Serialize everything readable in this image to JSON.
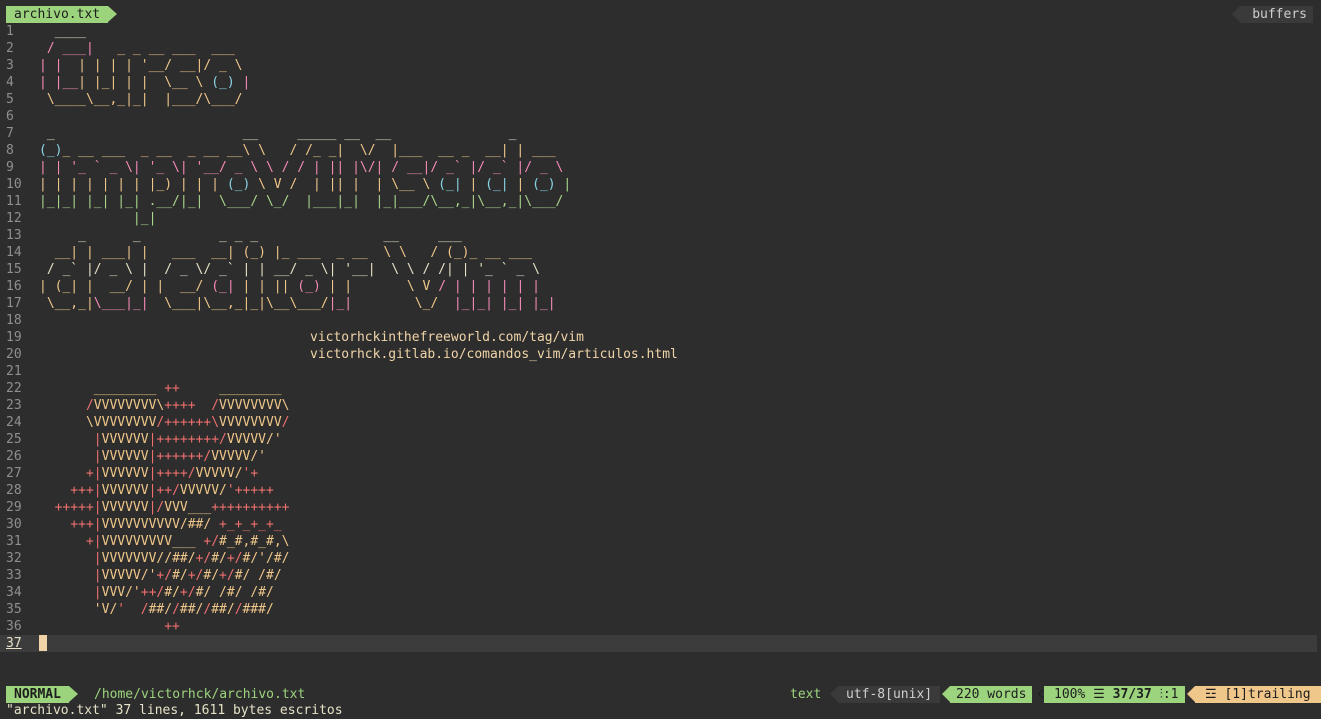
{
  "tabline": {
    "active_tab": "archivo.txt",
    "buffers_label": "buffers"
  },
  "colors": {
    "pink": "#f58ab8",
    "green": "#a8d68c",
    "blue": "#8ad5e6",
    "yellow": "#f0c78a",
    "red": "#f07070",
    "mode_bg": "#9cd37d",
    "background": "#2d2d2d"
  },
  "editor": {
    "line_numbers": [
      "1",
      "2",
      "3",
      "4",
      "5",
      "6",
      "7",
      "8",
      "9",
      "10",
      "11",
      "12",
      "13",
      "14",
      "15",
      "16",
      "17",
      "18",
      "19",
      "20",
      "21",
      "22",
      "23",
      "24",
      "25",
      "26",
      "27",
      "28",
      "29",
      "30",
      "31",
      "32",
      "33",
      "34",
      "35",
      "36",
      "37"
    ],
    "urls": [
      "victorhckinthefreeworld.com/tag/vim",
      "victorhck.gitlab.io/comandos_vim/articulos.html"
    ]
  },
  "statusline": {
    "mode": "NORMAL",
    "file_path": "/home/victorhck/archivo.txt",
    "filetype": "text",
    "encoding": "utf-8[unix]",
    "word_count": "220 words",
    "percent": "100%",
    "position": "37/37",
    "column": ":1",
    "trailing": "☲ [1]trailing"
  },
  "command_line": {
    "message": "\"archivo.txt\" 37 lines, 1611 bytes escritos"
  }
}
